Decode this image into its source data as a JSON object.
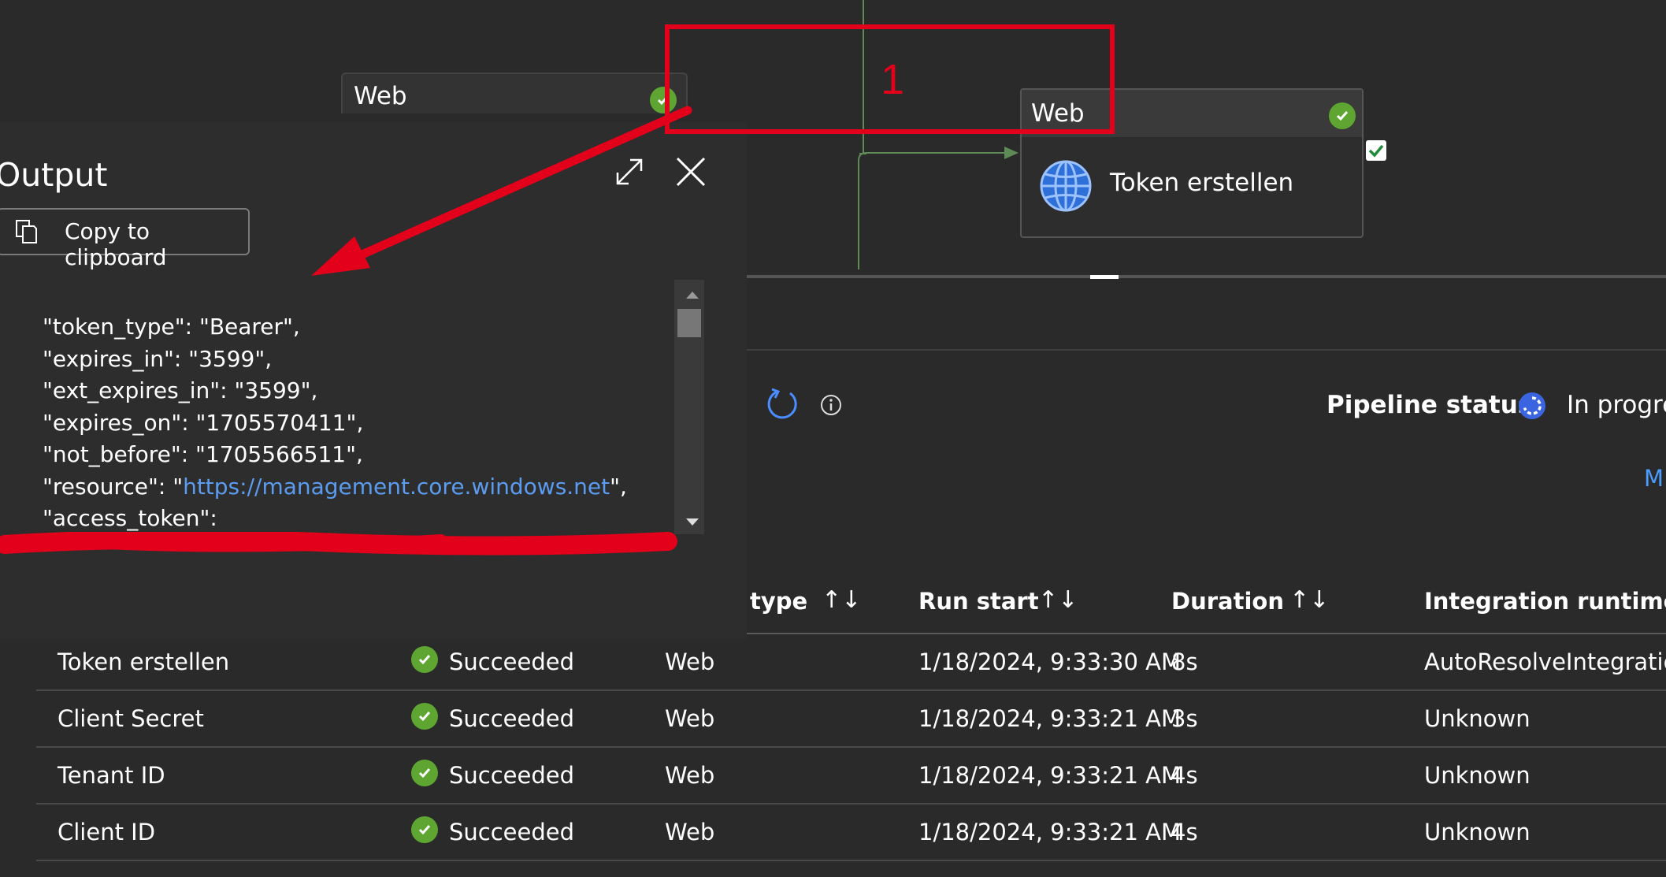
{
  "canvas": {
    "left_node": {
      "title": "Web"
    },
    "right_node": {
      "title": "Web",
      "label": "Token erstellen"
    },
    "annotation": {
      "number": "1",
      "color": "#e2001a"
    }
  },
  "toolbar": {
    "pipeline_status_label": "Pipeline status",
    "pipeline_status_value": "In progre",
    "link_partial": "M"
  },
  "table": {
    "columns": [
      "type",
      "Run start",
      "Duration",
      "Integration runtime"
    ],
    "rows": [
      {
        "name": "Token erstellen",
        "status": "Succeeded",
        "type": "Web",
        "run_start": "1/18/2024, 9:33:30 AM",
        "duration": "8s",
        "runtime": "AutoResolveIntegratior"
      },
      {
        "name": "Client Secret",
        "status": "Succeeded",
        "type": "Web",
        "run_start": "1/18/2024, 9:33:21 AM",
        "duration": "3s",
        "runtime": "Unknown"
      },
      {
        "name": "Tenant ID",
        "status": "Succeeded",
        "type": "Web",
        "run_start": "1/18/2024, 9:33:21 AM",
        "duration": "4s",
        "runtime": "Unknown"
      },
      {
        "name": "Client ID",
        "status": "Succeeded",
        "type": "Web",
        "run_start": "1/18/2024, 9:33:21 AM",
        "duration": "4s",
        "runtime": "Unknown"
      }
    ]
  },
  "output_panel": {
    "title": "Output",
    "copy_label": "Copy to clipboard",
    "lines": {
      "l1": "\"token_type\": \"Bearer\",",
      "l2": "\"expires_in\": \"3599\",",
      "l3": "\"ext_expires_in\": \"3599\",",
      "l4": "\"expires_on\": \"1705570411\",",
      "l5": "\"not_before\": \"1705566511\",",
      "l6_pre": "\"resource\": \"",
      "l6_url": "https://management.core.windows.net",
      "l6_post": "\",",
      "l7": "\"access_token\":"
    }
  },
  "colors": {
    "success": "#5fa531",
    "accent": "#4b9cff",
    "annotation": "#e2001a",
    "background": "#2a2a2a"
  },
  "icons": [
    "check-circle-icon",
    "globe-icon",
    "checkbox-icon",
    "refresh-icon",
    "info-icon",
    "progress-icon",
    "sort-icon",
    "expand-icon",
    "close-icon",
    "copy-icon",
    "scroll-up-icon",
    "scroll-down-icon"
  ]
}
